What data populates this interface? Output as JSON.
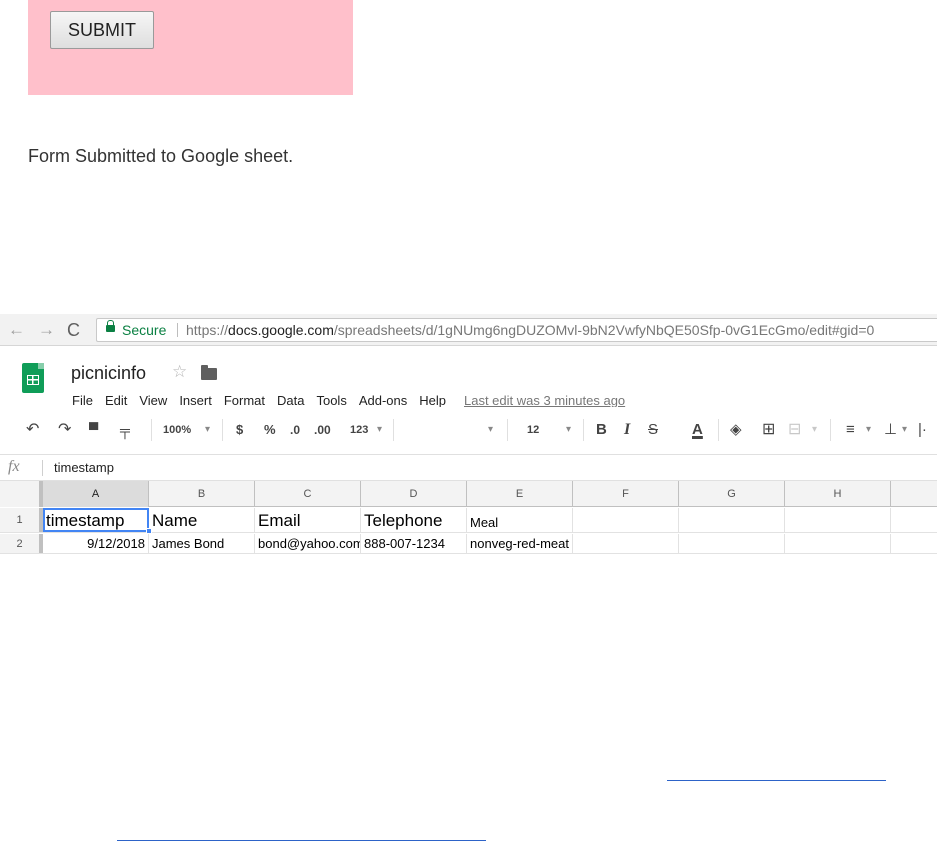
{
  "form": {
    "submit_label": "SUBMIT",
    "message": "Form Submitted to Google sheet.",
    "box_color": "#ffc0cb"
  },
  "browser": {
    "nav": {
      "back_icon": "←",
      "forward_icon": "→",
      "reload_icon": "C"
    },
    "address": {
      "secure_label": "Secure",
      "url_scheme": "https://",
      "url_host": "docs.google.com",
      "url_path": "/spreadsheets/d/1gNUmg6ngDUZOMvl-9bN2VwfyNbQE50Sfp-0vG1EcGmo/edit#gid=0"
    }
  },
  "sheet": {
    "title": "picnicinfo",
    "star_icon": "☆",
    "menu": [
      "File",
      "Edit",
      "View",
      "Insert",
      "Format",
      "Data",
      "Tools",
      "Add-ons",
      "Help"
    ],
    "last_edit": "Last edit was 3 minutes ago",
    "toolbar": {
      "undo": "↶",
      "redo": "↷",
      "print": "▀",
      "paint_format": "╤",
      "zoom": "100%",
      "dropdown": "▾",
      "currency": "$",
      "percent": "%",
      "dec_decrease": ".0",
      "dec_increase": ".00",
      "more_formats": "123",
      "font_size": "12",
      "bold": "B",
      "italic": "I",
      "strike": "S",
      "text_color": "A",
      "fill_color": "◈",
      "borders": "⊞",
      "merge": "⊟",
      "h_align": "≡",
      "v_align": "⊥",
      "wrap": "|·"
    },
    "formula_bar": {
      "fx": "fx",
      "content": "timestamp"
    },
    "columns": [
      "A",
      "B",
      "C",
      "D",
      "E",
      "F",
      "G",
      "H"
    ],
    "rows": [
      {
        "num": "1",
        "cells": [
          "timestamp",
          "Name",
          "Email",
          "Telephone",
          "Meal",
          "",
          "",
          ""
        ]
      },
      {
        "num": "2",
        "cells": [
          "9/12/2018",
          "James Bond",
          "bond@yahoo.com",
          "888-007-1234",
          "nonveg-red-meat",
          "",
          "",
          ""
        ]
      }
    ]
  }
}
